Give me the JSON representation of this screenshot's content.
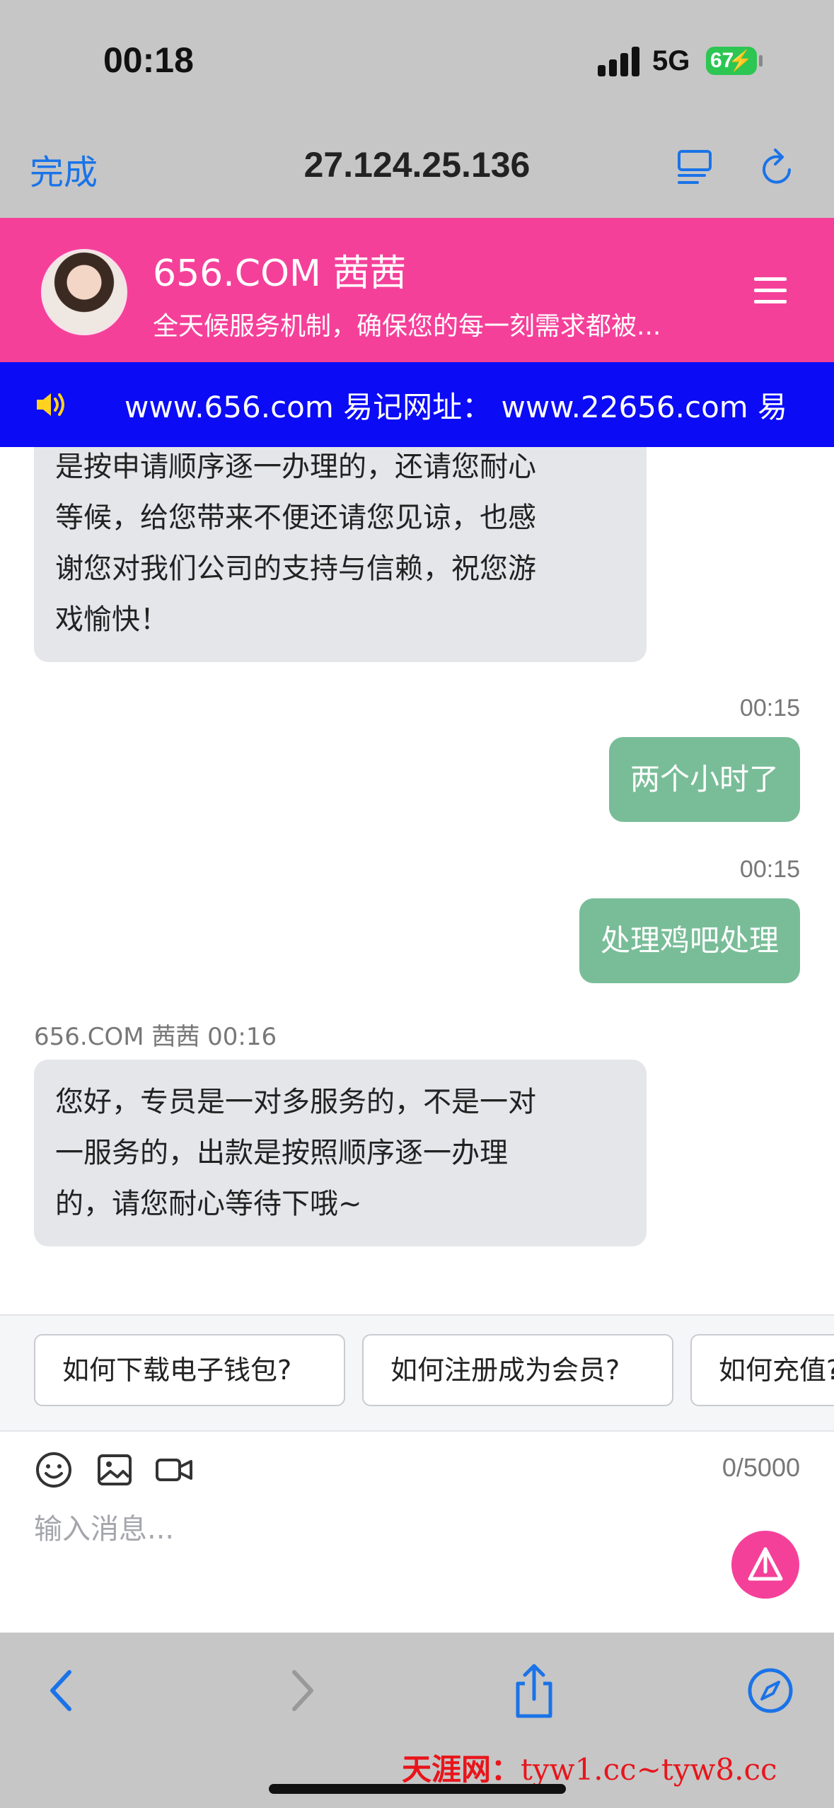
{
  "status_bar": {
    "time": "00:18",
    "network": "5G",
    "battery": "67"
  },
  "browser": {
    "done_label": "完成",
    "url": "27.124.25.136",
    "icons": [
      "reader-icon",
      "reload-icon"
    ]
  },
  "header": {
    "agent_name": "656.COM 茜茜",
    "description": "全天候服务机制，确保您的每一刻需求都被...",
    "icons": [
      "avatar",
      "menu-icon"
    ],
    "color": "#f5409a"
  },
  "marquee": {
    "text": "www.656.com 易记网址： www.22656.com 易",
    "color": "#0b0bf5"
  },
  "messages": [
    {
      "direction": "in",
      "lines": [
        "是按申请顺序逐一办理的，还请您耐心",
        "等候，给您带来不便还请您见谅，也感",
        "谢您对我们公司的支持与信赖，祝您游",
        "戏愉快！"
      ]
    },
    {
      "direction": "out",
      "time": "00:15",
      "text": "两个小时了"
    },
    {
      "direction": "out",
      "time": "00:15",
      "text": "处理鸡吧处理"
    },
    {
      "direction": "in",
      "sender": "656.COM 茜茜 00:16",
      "lines": [
        "您好，专员是一对多服务的，不是一对",
        "一服务的，出款是按照顺序逐一办理",
        "的，请您耐心等待下哦~"
      ]
    }
  ],
  "quick_replies": [
    "如何下载电子钱包?",
    "如何注册成为会员?",
    "如何充值?"
  ],
  "composer": {
    "counter": "0/5000",
    "placeholder": "输入消息...",
    "tools": [
      "emoji-icon",
      "image-icon",
      "video-icon"
    ],
    "send_icon": "send-icon"
  },
  "bottom_toolbar": {
    "icons": [
      "back-icon",
      "forward-icon",
      "share-icon",
      "compass-icon"
    ],
    "watermark": "天涯网：",
    "watermark_url": "tyw1.cc~tyw8.cc"
  }
}
